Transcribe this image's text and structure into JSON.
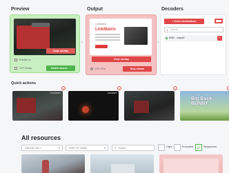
{
  "sections": {
    "preview": "Preview",
    "output": "Output",
    "decoders": "Decoders",
    "quick_actions": "Quick actions",
    "all_resources": "All resources"
  },
  "preview": {
    "clear_overlay": "Clear overlay",
    "switch_source": "Switch source →",
    "publish_to": "Publish to",
    "vst_delay": "VST Delay"
  },
  "output": {
    "thumb_brand": "LiveMatrix",
    "thumb_headline": "LinkMatrix",
    "clear_overlay": "Clear overlay",
    "timer": "07h 37m",
    "stop_stream": "Stop stream"
  },
  "decoders": {
    "select_button": "+ Select destinations",
    "search_placeholder": "Search",
    "items": [
      {
        "label": "8460 - output2",
        "status_color": "#4db44a"
      }
    ]
  },
  "quick_actions": {
    "items": [
      {
        "label": "Livestream"
      },
      {
        "label": "Landstart"
      },
      {
        "label": ""
      },
      {
        "label": "Big Buck BUNNY"
      }
    ]
  },
  "resources": {
    "filter_type": "ONLINE ONLY",
    "filter_sort": "SORT BY NAME",
    "search_placeholder": "Search",
    "check_clips": "Clips",
    "check_encoders": "Encoders",
    "check_sequences": "Sequences",
    "sequences_checked": true
  },
  "colors": {
    "accent_red": "#e04747",
    "accent_green": "#4db44a",
    "preview_bg": "#c8efc0",
    "output_bg": "#f5c2c2"
  }
}
